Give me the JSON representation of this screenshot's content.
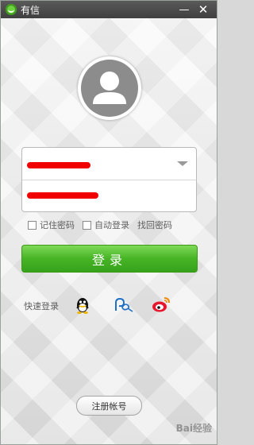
{
  "titlebar": {
    "app_name": "有信",
    "minimize_symbol": "—",
    "close_symbol": "✕"
  },
  "avatar": {
    "icon": "user-silhouette-icon"
  },
  "login_form": {
    "account_value": "",
    "password_value": "",
    "remember_password_label": "记住密码",
    "auto_login_label": "自动登录",
    "find_password_label": "找回密码",
    "login_button_label": "登录"
  },
  "quick_login": {
    "label": "快速登录",
    "providers": [
      "qq-icon",
      "alipay-icon",
      "weibo-icon"
    ]
  },
  "footer": {
    "register_label": "注册帐号",
    "watermark": "Bai经验"
  },
  "colors": {
    "titlebar": "#4a4a4a",
    "brand_green": "#47b426",
    "redaction": "#f00000"
  }
}
